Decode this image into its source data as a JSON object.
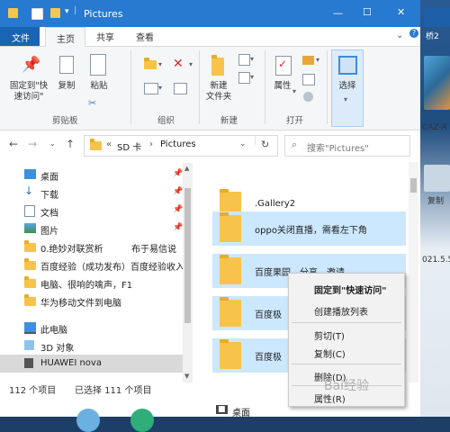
{
  "window": {
    "title": "Pictures",
    "minimize": "—",
    "maximize": "☐",
    "close": "✕"
  },
  "tabs": [
    {
      "label": "文件"
    },
    {
      "label": "主页"
    },
    {
      "label": "共享"
    },
    {
      "label": "查看"
    }
  ],
  "ribbon": {
    "clipboard": {
      "pin_label_1": "固定到\"快",
      "pin_label_2": "速访问\"",
      "copy_label": "复制",
      "paste_label": "粘贴",
      "group_label": "剪贴板"
    },
    "organize": {
      "group_label": "组织"
    },
    "new": {
      "newfolder_label_1": "新建",
      "newfolder_label_2": "文件夹",
      "group_label": "新建"
    },
    "open": {
      "properties_label": "属性",
      "group_label": "打开"
    },
    "select": {
      "select_label": "选择"
    }
  },
  "address": {
    "prefix": "«",
    "path1": "SD 卡",
    "sep": "›",
    "path2": "Pictures",
    "search_placeholder": "搜索\"Pictures\""
  },
  "nav": {
    "items": [
      {
        "label": "桌面",
        "pinned": true
      },
      {
        "label": "下载",
        "pinned": true
      },
      {
        "label": "文档",
        "pinned": true
      },
      {
        "label": "图片",
        "pinned": true
      },
      {
        "label": "0.绝妙对联赏析",
        "suffix": "布于易信说"
      },
      {
        "label": "百度经验（成功发布）百度经验收入"
      },
      {
        "label": "电脑、很响的噙声，F1"
      },
      {
        "label": "华为移动文件到电脑"
      },
      {
        "label": "此电脑"
      },
      {
        "label": "3D 对象"
      },
      {
        "label": "HUAWEI nova"
      }
    ]
  },
  "files": [
    {
      "name": ".Gallery2"
    },
    {
      "name": "oppo关闭直播，需看左下角"
    },
    {
      "name": "百度果园，分享，邀请"
    },
    {
      "name": "百度极"
    },
    {
      "name": "百度极"
    }
  ],
  "status": {
    "count": "112 个项目",
    "selected": "已选择 111 个项目"
  },
  "context_menu": {
    "items": [
      {
        "label": "固定到\"快速访问\""
      },
      {
        "label": "创建播放列表"
      },
      {
        "label": "剪切(T)"
      },
      {
        "label": "复制(C)"
      },
      {
        "label": "删除(D)"
      },
      {
        "label": "属性(R)"
      }
    ]
  },
  "desktop_right": {
    "label1": "桥2",
    "label2": "CAZ-A",
    "label3": "复制",
    "label4": "021.5.5"
  },
  "taskbar_bottom": {
    "desktop_label": "桌面"
  },
  "watermark": "Bai经验",
  "colors": {
    "titlebar": "#2879d0",
    "selection": "#cce8ff",
    "folder": "#f7c34b"
  }
}
